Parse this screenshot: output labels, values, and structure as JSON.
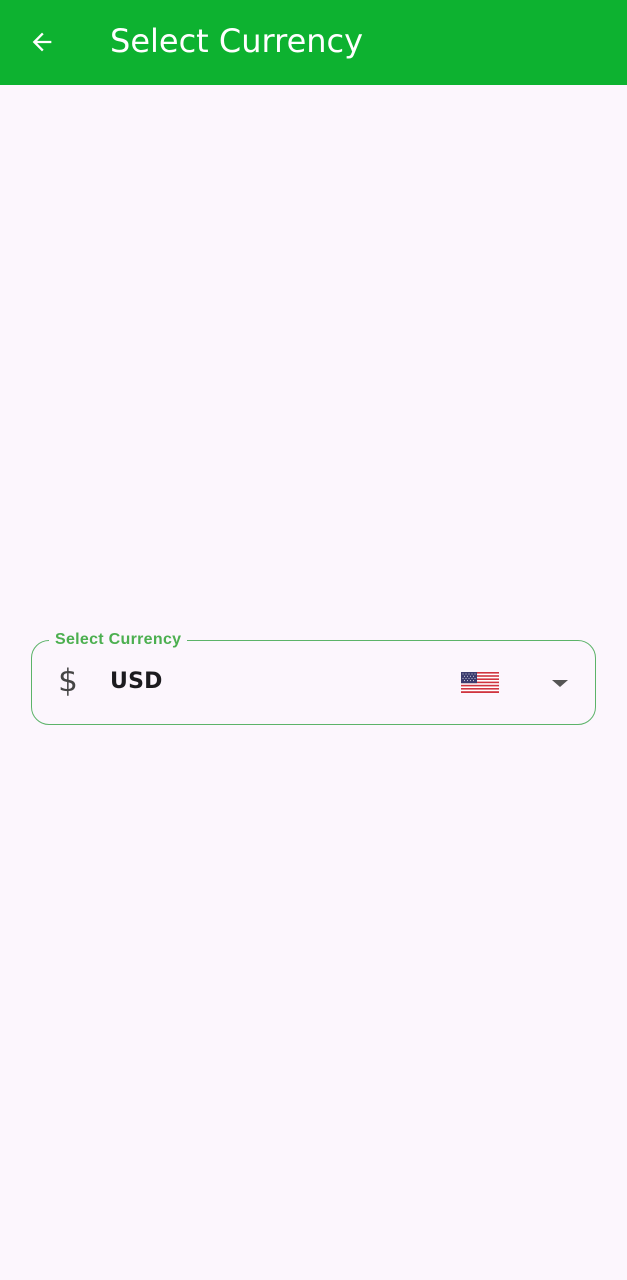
{
  "app_bar": {
    "title": "Select Currency",
    "back_icon": "arrow-back-icon",
    "color": "#0db230"
  },
  "currency_field": {
    "label": "Select Currency",
    "symbol": "$",
    "selected_value": "USD",
    "flag_icon": "us-flag-icon",
    "dropdown_icon": "arrow-drop-down-icon",
    "accent_color": "#4caf50"
  }
}
